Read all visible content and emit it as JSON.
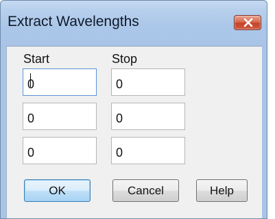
{
  "window": {
    "title": "Extract Wavelengths",
    "close_icon": "close-icon",
    "accent_close": "#c4432a"
  },
  "labels": {
    "start": "Start",
    "stop": "Stop"
  },
  "rows": [
    {
      "start": "0",
      "stop": "0"
    },
    {
      "start": "0",
      "stop": "0"
    },
    {
      "start": "0",
      "stop": "0"
    }
  ],
  "buttons": {
    "ok": "OK",
    "cancel": "Cancel",
    "help": "Help"
  }
}
